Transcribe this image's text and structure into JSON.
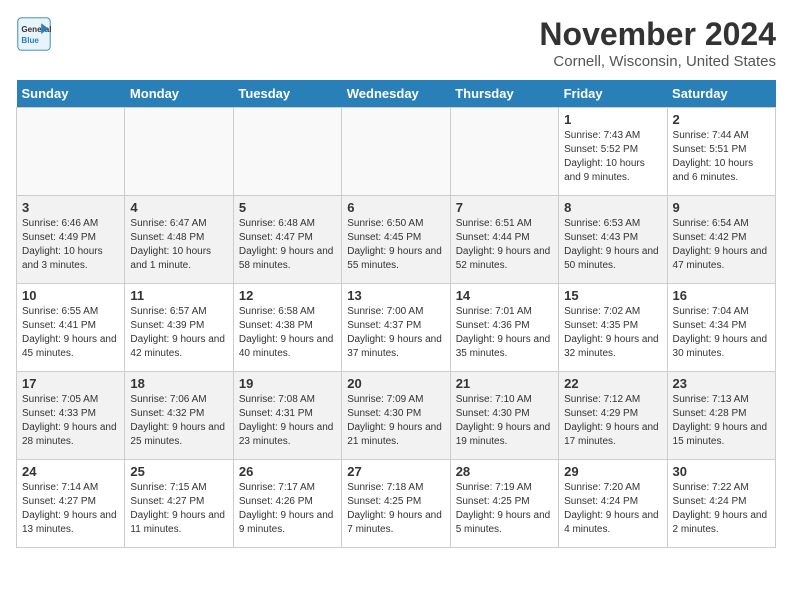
{
  "header": {
    "logo_line1": "General",
    "logo_line2": "Blue",
    "month_title": "November 2024",
    "location": "Cornell, Wisconsin, United States"
  },
  "days_of_week": [
    "Sunday",
    "Monday",
    "Tuesday",
    "Wednesday",
    "Thursday",
    "Friday",
    "Saturday"
  ],
  "weeks": [
    [
      {
        "day": "",
        "info": ""
      },
      {
        "day": "",
        "info": ""
      },
      {
        "day": "",
        "info": ""
      },
      {
        "day": "",
        "info": ""
      },
      {
        "day": "",
        "info": ""
      },
      {
        "day": "1",
        "info": "Sunrise: 7:43 AM\nSunset: 5:52 PM\nDaylight: 10 hours and 9 minutes."
      },
      {
        "day": "2",
        "info": "Sunrise: 7:44 AM\nSunset: 5:51 PM\nDaylight: 10 hours and 6 minutes."
      }
    ],
    [
      {
        "day": "3",
        "info": "Sunrise: 6:46 AM\nSunset: 4:49 PM\nDaylight: 10 hours and 3 minutes."
      },
      {
        "day": "4",
        "info": "Sunrise: 6:47 AM\nSunset: 4:48 PM\nDaylight: 10 hours and 1 minute."
      },
      {
        "day": "5",
        "info": "Sunrise: 6:48 AM\nSunset: 4:47 PM\nDaylight: 9 hours and 58 minutes."
      },
      {
        "day": "6",
        "info": "Sunrise: 6:50 AM\nSunset: 4:45 PM\nDaylight: 9 hours and 55 minutes."
      },
      {
        "day": "7",
        "info": "Sunrise: 6:51 AM\nSunset: 4:44 PM\nDaylight: 9 hours and 52 minutes."
      },
      {
        "day": "8",
        "info": "Sunrise: 6:53 AM\nSunset: 4:43 PM\nDaylight: 9 hours and 50 minutes."
      },
      {
        "day": "9",
        "info": "Sunrise: 6:54 AM\nSunset: 4:42 PM\nDaylight: 9 hours and 47 minutes."
      }
    ],
    [
      {
        "day": "10",
        "info": "Sunrise: 6:55 AM\nSunset: 4:41 PM\nDaylight: 9 hours and 45 minutes."
      },
      {
        "day": "11",
        "info": "Sunrise: 6:57 AM\nSunset: 4:39 PM\nDaylight: 9 hours and 42 minutes."
      },
      {
        "day": "12",
        "info": "Sunrise: 6:58 AM\nSunset: 4:38 PM\nDaylight: 9 hours and 40 minutes."
      },
      {
        "day": "13",
        "info": "Sunrise: 7:00 AM\nSunset: 4:37 PM\nDaylight: 9 hours and 37 minutes."
      },
      {
        "day": "14",
        "info": "Sunrise: 7:01 AM\nSunset: 4:36 PM\nDaylight: 9 hours and 35 minutes."
      },
      {
        "day": "15",
        "info": "Sunrise: 7:02 AM\nSunset: 4:35 PM\nDaylight: 9 hours and 32 minutes."
      },
      {
        "day": "16",
        "info": "Sunrise: 7:04 AM\nSunset: 4:34 PM\nDaylight: 9 hours and 30 minutes."
      }
    ],
    [
      {
        "day": "17",
        "info": "Sunrise: 7:05 AM\nSunset: 4:33 PM\nDaylight: 9 hours and 28 minutes."
      },
      {
        "day": "18",
        "info": "Sunrise: 7:06 AM\nSunset: 4:32 PM\nDaylight: 9 hours and 25 minutes."
      },
      {
        "day": "19",
        "info": "Sunrise: 7:08 AM\nSunset: 4:31 PM\nDaylight: 9 hours and 23 minutes."
      },
      {
        "day": "20",
        "info": "Sunrise: 7:09 AM\nSunset: 4:30 PM\nDaylight: 9 hours and 21 minutes."
      },
      {
        "day": "21",
        "info": "Sunrise: 7:10 AM\nSunset: 4:30 PM\nDaylight: 9 hours and 19 minutes."
      },
      {
        "day": "22",
        "info": "Sunrise: 7:12 AM\nSunset: 4:29 PM\nDaylight: 9 hours and 17 minutes."
      },
      {
        "day": "23",
        "info": "Sunrise: 7:13 AM\nSunset: 4:28 PM\nDaylight: 9 hours and 15 minutes."
      }
    ],
    [
      {
        "day": "24",
        "info": "Sunrise: 7:14 AM\nSunset: 4:27 PM\nDaylight: 9 hours and 13 minutes."
      },
      {
        "day": "25",
        "info": "Sunrise: 7:15 AM\nSunset: 4:27 PM\nDaylight: 9 hours and 11 minutes."
      },
      {
        "day": "26",
        "info": "Sunrise: 7:17 AM\nSunset: 4:26 PM\nDaylight: 9 hours and 9 minutes."
      },
      {
        "day": "27",
        "info": "Sunrise: 7:18 AM\nSunset: 4:25 PM\nDaylight: 9 hours and 7 minutes."
      },
      {
        "day": "28",
        "info": "Sunrise: 7:19 AM\nSunset: 4:25 PM\nDaylight: 9 hours and 5 minutes."
      },
      {
        "day": "29",
        "info": "Sunrise: 7:20 AM\nSunset: 4:24 PM\nDaylight: 9 hours and 4 minutes."
      },
      {
        "day": "30",
        "info": "Sunrise: 7:22 AM\nSunset: 4:24 PM\nDaylight: 9 hours and 2 minutes."
      }
    ]
  ]
}
